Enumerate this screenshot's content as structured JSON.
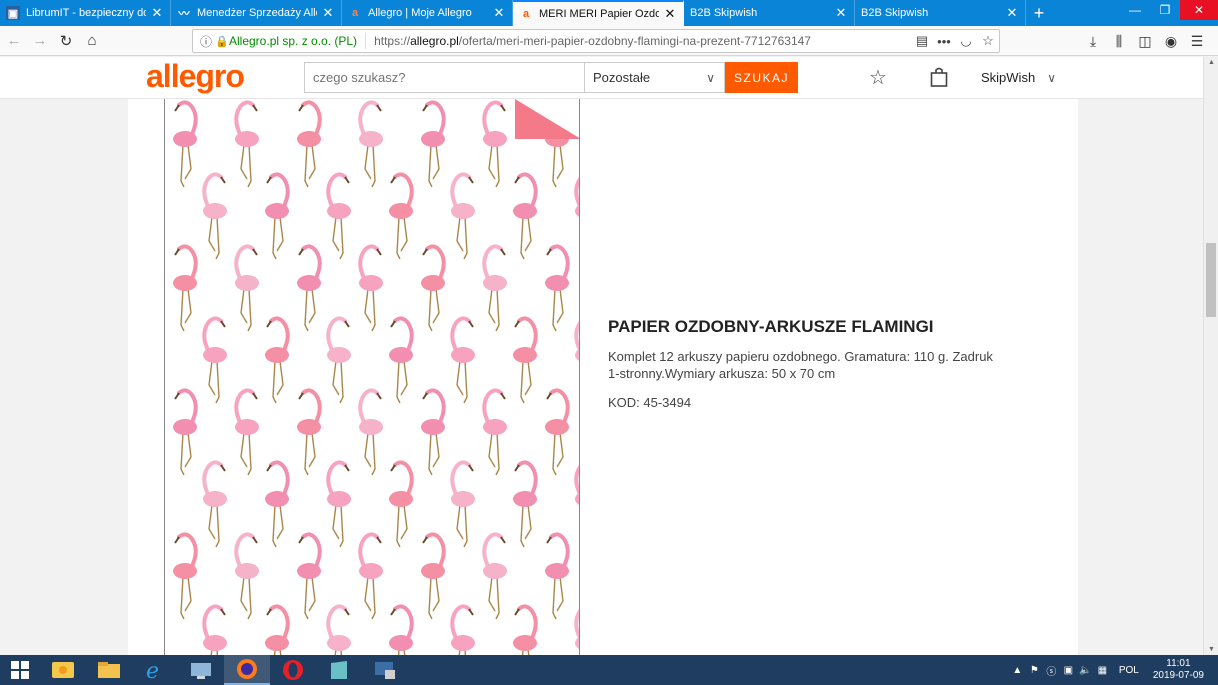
{
  "tabs": [
    {
      "title": "LibrumIT - bezpieczny dostęp z",
      "favicon": "librum-icon",
      "active": false
    },
    {
      "title": "Menedżer Sprzedaży Allegro.pl",
      "favicon": "chart-icon",
      "active": false
    },
    {
      "title": "Allegro | Moje Allegro",
      "favicon": "allegro-icon",
      "active": false
    },
    {
      "title": "MERI MERI Papier Ozdobny Fla",
      "favicon": "allegro-icon",
      "active": true
    },
    {
      "title": "B2B Skipwish",
      "favicon": "",
      "active": false
    },
    {
      "title": "B2B Skipwish",
      "favicon": "",
      "active": false
    }
  ],
  "urlbar": {
    "org": "Allegro.pl sp. z o.o. (PL)",
    "url_prefix": "https://",
    "url_domain": "allegro.pl",
    "url_path": "/oferta/meri-meri-papier-ozdobny-flamingi-na-prezent-7712763147"
  },
  "header": {
    "logo": "allegro",
    "search_placeholder": "czego szukasz?",
    "category": "Pozostałe",
    "search_button": "SZUKAJ",
    "user": "SkipWish"
  },
  "product": {
    "title": "PAPIER OZDOBNY-ARKUSZE FLAMINGI",
    "description": "Komplet 12 arkuszy papieru ozdobnego. Gramatura: 110 g. Zadruk 1-stronny.Wymiary arkusza: 50 x 70 cm",
    "code": "KOD: 45-3494"
  },
  "taskbar": {
    "lang": "POL",
    "time": "11:01",
    "date": "2019-07-09"
  },
  "colors": {
    "brand": "#ff5a00",
    "tabbar": "#0a84d6",
    "flamingo": "#f28fb0",
    "legs": "#a8874a"
  }
}
